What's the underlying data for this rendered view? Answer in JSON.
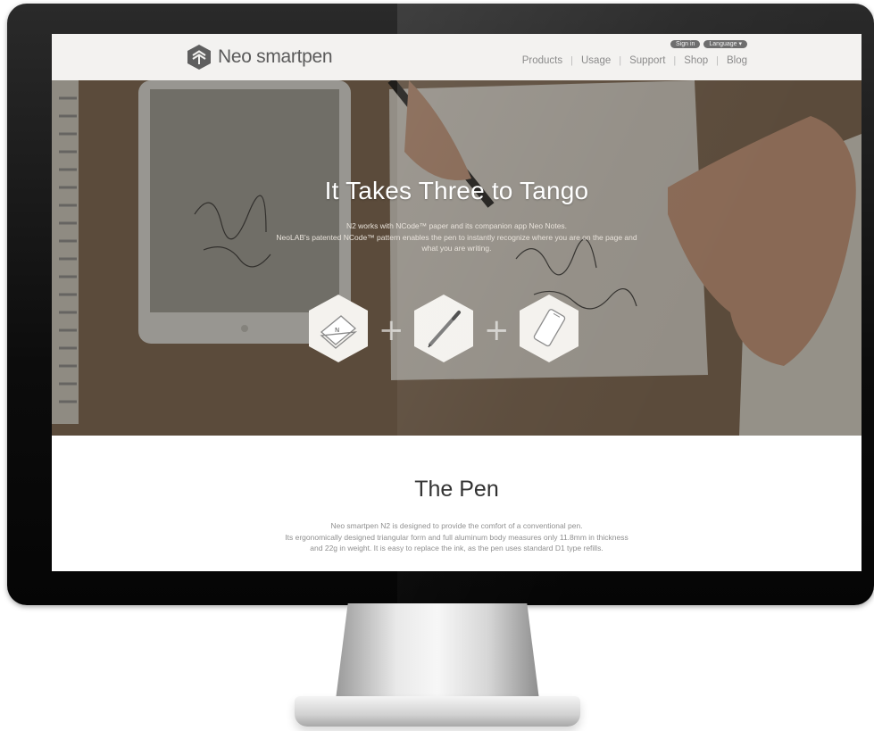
{
  "site": {
    "brand": "Neo smartpen",
    "utility": {
      "sign_in": "Sign in",
      "language": "Language ▾"
    },
    "nav": [
      "Products",
      "Usage",
      "Support",
      "Shop",
      "Blog"
    ]
  },
  "hero": {
    "title": "It Takes Three to Tango",
    "lines": [
      "N2 works with NCode™ paper and its companion app Neo Notes.",
      "NeoLAB's patented NCode™ pattern enables the pen to instantly recognize where you are on the page and",
      "what you are writing."
    ],
    "steps": [
      {
        "icon": "notepad-icon"
      },
      {
        "icon": "pen-icon"
      },
      {
        "icon": "phone-icon"
      }
    ]
  },
  "pen_section": {
    "title": "The Pen",
    "lines": [
      "Neo smartpen N2 is designed to provide the comfort of a conventional pen.",
      "Its ergonomically designed triangular form and full aluminum body measures only 11.8mm in thickness",
      "and 22g in weight. It is easy to replace the ink, as the pen uses standard D1 type refills."
    ]
  },
  "colors": {
    "header_bg": "#f3f2f0",
    "nav_text": "#8b8b8b",
    "pill_bg": "#6e6e6e",
    "hero_text": "#ffffff"
  }
}
